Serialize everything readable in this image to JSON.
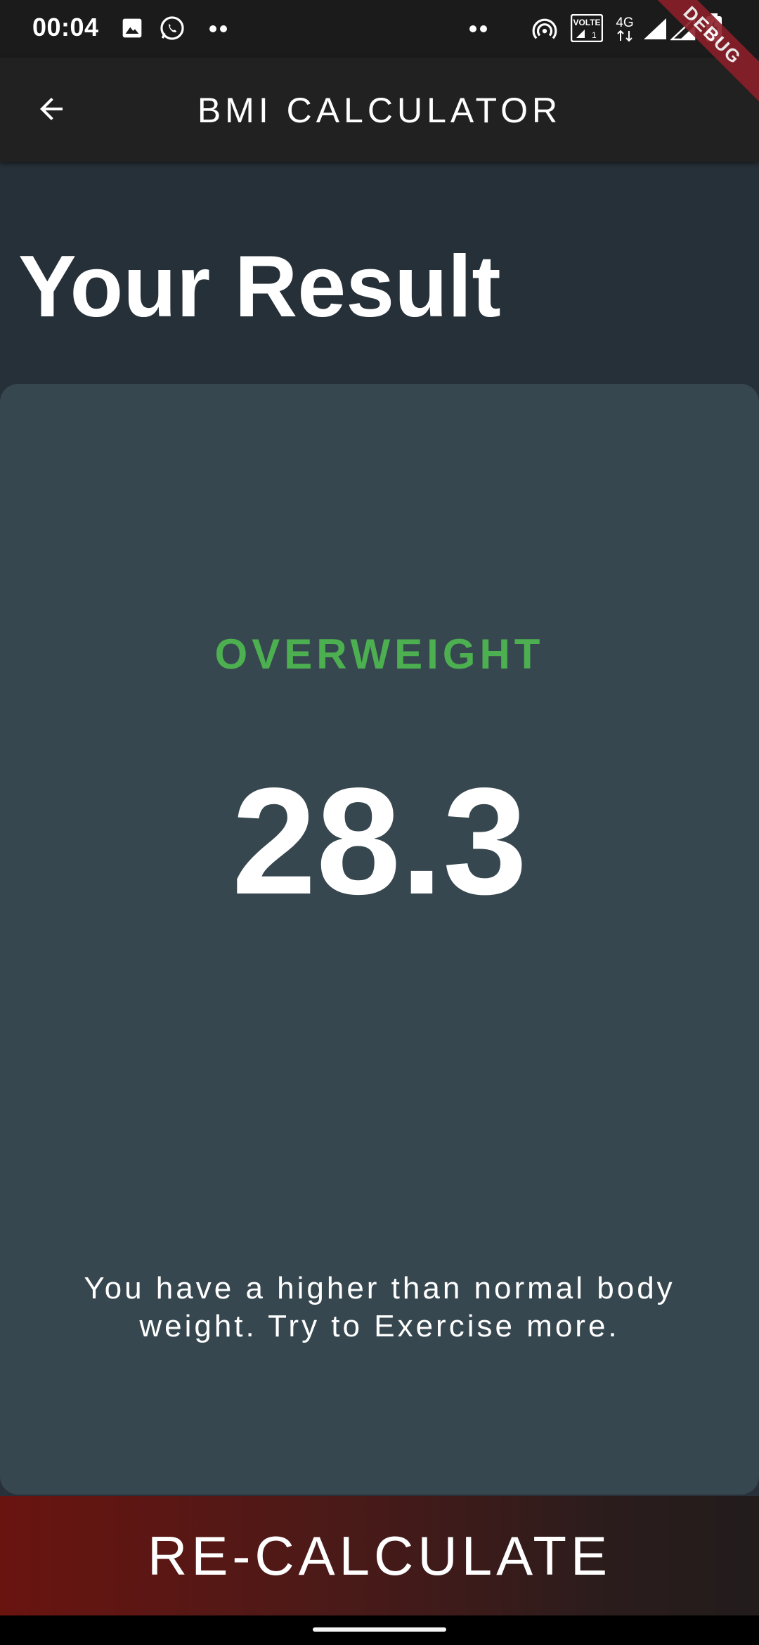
{
  "status_bar": {
    "time": "00:04",
    "icons": [
      "gallery-icon",
      "whatsapp-icon",
      "more-dots-icon",
      "more-dots-icon",
      "hotspot-icon",
      "volte-icon",
      "4g-icon",
      "signal-icon",
      "signal-icon",
      "battery-icon"
    ]
  },
  "app_bar": {
    "title": "BMI CALCULATOR",
    "back_icon": "arrow-back-icon"
  },
  "debug_banner": "DEBUG",
  "main": {
    "heading": "Your Result",
    "result": {
      "category": "OVERWEIGHT",
      "bmi": "28.3",
      "advice": "You have a higher than normal body weight. Try to Exercise more."
    }
  },
  "footer": {
    "button_label": "RE-CALCULATE"
  },
  "colors": {
    "background": "#263238",
    "card": "#37474f",
    "category": "#4caf50",
    "app_bar": "#212121",
    "button_gradient_start": "#6a1410"
  }
}
